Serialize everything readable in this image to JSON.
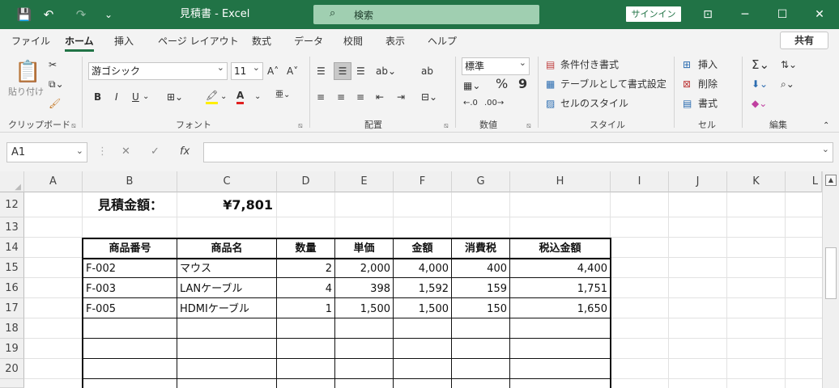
{
  "titlebar": {
    "save_icon": "💾",
    "undo_icon": "↶",
    "redo_icon": "↷",
    "customize_icon": "⌄",
    "title": "見積書  -  Excel",
    "search_placeholder": "検索",
    "search_icon": "⌕",
    "signin": "サインイン",
    "ribbon_display_icon": "⊡",
    "minimize": "─",
    "restore": "☐",
    "close": "✕"
  },
  "tabs": [
    "ファイル",
    "ホーム",
    "挿入",
    "ページ レイアウト",
    "数式",
    "データ",
    "校閲",
    "表示",
    "ヘルプ"
  ],
  "active_tab": "ホーム",
  "share_label": "共有",
  "ribbon": {
    "clipboard": {
      "paste": "貼り付け",
      "label": "クリップボード"
    },
    "font": {
      "name": "游ゴシック",
      "size": "11",
      "bold": "B",
      "italic": "I",
      "underline": "U",
      "grow": "A^",
      "shrink": "Aˇ",
      "label": "フォント"
    },
    "alignment": {
      "label": "配置"
    },
    "number": {
      "format": "標準",
      "percent": "%",
      "comma": "9",
      "label": "数値"
    },
    "styles": {
      "conditional": "条件付き書式",
      "table": "テーブルとして書式設定",
      "cell": "セルのスタイル",
      "label": "スタイル"
    },
    "cells": {
      "insert": "挿入",
      "delete": "削除",
      "format": "書式",
      "label": "セル"
    },
    "editing": {
      "label": "編集"
    }
  },
  "formula_bar": {
    "name_box": "A1",
    "cancel": "✕",
    "enter": "✓",
    "fx": "fx",
    "value": ""
  },
  "accent_color": "#217346",
  "columns": [
    "A",
    "B",
    "C",
    "D",
    "E",
    "F",
    "G",
    "H",
    "I",
    "J",
    "K",
    "L"
  ],
  "rows": [
    "12",
    "13",
    "14",
    "15",
    "16",
    "17",
    "18",
    "19",
    "20"
  ],
  "summary": {
    "label": "見積金額：",
    "value": "¥7,801"
  },
  "table": {
    "headers": [
      "商品番号",
      "商品名",
      "数量",
      "単価",
      "金額",
      "消費税",
      "税込金額"
    ],
    "rows": [
      [
        "F-002",
        "マウス",
        "2",
        "2,000",
        "4,000",
        "400",
        "4,400"
      ],
      [
        "F-003",
        "LANケーブル",
        "4",
        "398",
        "1,592",
        "159",
        "1,751"
      ],
      [
        "F-005",
        "HDMIケーブル",
        "1",
        "1,500",
        "1,500",
        "150",
        "1,650"
      ]
    ]
  }
}
